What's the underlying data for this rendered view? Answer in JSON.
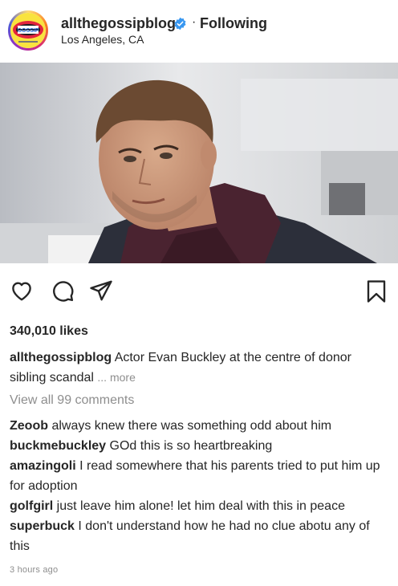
{
  "header": {
    "username": "allthegossipblog",
    "separator": "·",
    "follow_state": "Following",
    "location": "Los Angeles, CA",
    "avatar_text": "GOSSIP",
    "verified_color": "#3897f0"
  },
  "actions": {
    "like_icon": "heart-icon",
    "comment_icon": "comment-icon",
    "share_icon": "paper-plane-icon",
    "save_icon": "bookmark-icon"
  },
  "likes": "340,010 likes",
  "caption": {
    "username": "allthegossipblog",
    "text": "Actor Evan Buckley at the centre of donor sibling scandal",
    "more": "... more"
  },
  "view_all": "View all 99 comments",
  "comments": [
    {
      "username": "Zeoob",
      "text": "always knew there was something odd about him"
    },
    {
      "username": "buckmebuckley",
      "text": "GOd this is so heartbreaking"
    },
    {
      "username": "amazingoli",
      "text": "I read somewhere that his parents tried to put him up for adoption"
    },
    {
      "username": "golfgirl",
      "text": "just leave him alone! let him deal with this in peace"
    },
    {
      "username": "superbuck",
      "text": "I don't understand how he had no clue abotu any of this"
    }
  ],
  "timestamp": "3 hours ago"
}
